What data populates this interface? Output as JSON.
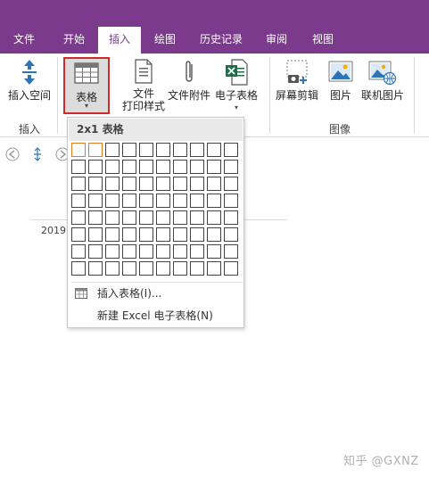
{
  "tabs": [
    {
      "label": "文件",
      "active": false
    },
    {
      "label": "开始",
      "active": false
    },
    {
      "label": "插入",
      "active": true
    },
    {
      "label": "绘图",
      "active": false
    },
    {
      "label": "历史记录",
      "active": false
    },
    {
      "label": "审阅",
      "active": false
    },
    {
      "label": "视图",
      "active": false
    }
  ],
  "ribbon": {
    "insert_space": "插入空间",
    "table": "表格",
    "file_printout_line1": "文件",
    "file_printout_line2": "打印样式",
    "file_attachment": "文件附件",
    "spreadsheet": "电子表格",
    "screen_clipping": "屏幕剪辑",
    "picture": "图片",
    "online_picture": "联机图片",
    "group_insert": "插入",
    "group_images": "图像"
  },
  "page": {
    "date_partial": "2019"
  },
  "dropdown": {
    "header": "2x1 表格",
    "grid_cols": 10,
    "grid_rows": 8,
    "selected_cols": 2,
    "selected_rows": 1,
    "insert_table": "插入表格(I)...",
    "new_excel": "新建 Excel 电子表格(N)"
  },
  "watermark": "知乎 @GXNZ",
  "colors": {
    "accent": "#7b3a8c",
    "selection_border": "#e07b20",
    "highlight_border": "#d02b2b"
  }
}
